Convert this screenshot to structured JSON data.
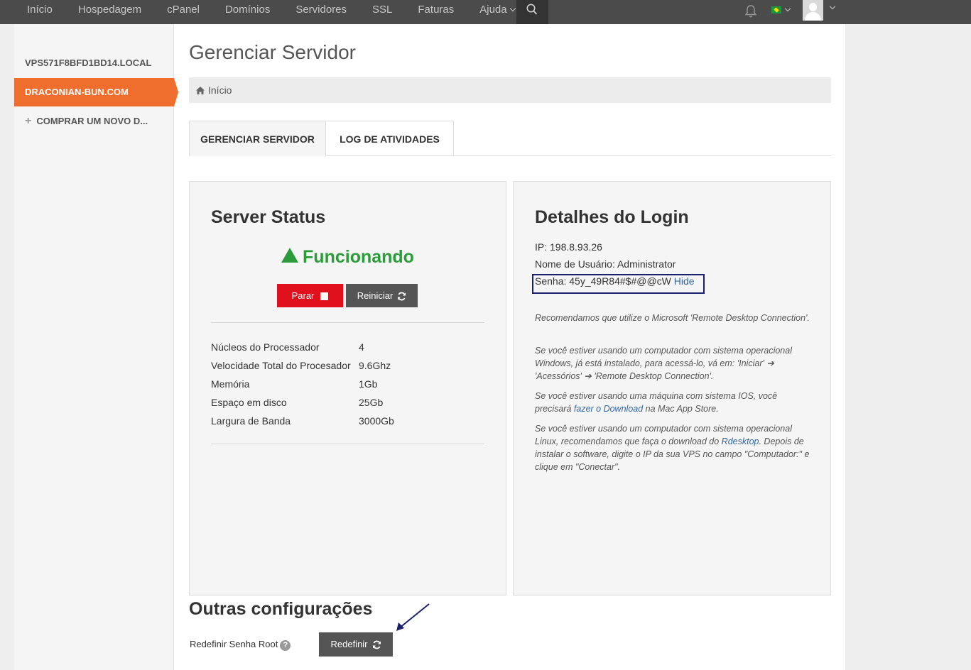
{
  "nav": {
    "items": [
      "Início",
      "Hospedagem",
      "cPanel",
      "Domínios",
      "Servidores",
      "SSL",
      "Faturas",
      "Ajuda"
    ]
  },
  "icons": {
    "search": "search-icon",
    "bell": "bell-icon",
    "flag": "brazil-flag-icon",
    "avatar": "user-avatar-icon",
    "home": "home-icon",
    "refresh": "refresh-icon",
    "stop": "stop-icon",
    "help": "question-circle-icon",
    "status": "up-triangle-icon"
  },
  "sidebar": {
    "items": [
      {
        "label": "VPS571F8BFD1BD14.LOCAL"
      },
      {
        "label": "DRACONIAN-BUN.COM"
      },
      {
        "label": "COMPRAR UM NOVO D..."
      }
    ]
  },
  "page": {
    "title": "Gerenciar Servidor",
    "breadcrumb": "Início"
  },
  "tabs": [
    "GERENCIAR SERVIDOR",
    "LOG DE ATIVIDADES"
  ],
  "server_status": {
    "title": "Server Status",
    "status": "Funcionando",
    "stop_label": "Parar",
    "restart_label": "Reiniciar",
    "specs": [
      {
        "key": "Núcleos do Processador",
        "value": "4"
      },
      {
        "key": "Velocidade Total do Procesador",
        "value": "9.6Ghz"
      },
      {
        "key": "Memória",
        "value": "1Gb"
      },
      {
        "key": "Espaço em disco",
        "value": "25Gb"
      },
      {
        "key": "Largura de Banda",
        "value": "3000Gb"
      }
    ]
  },
  "login": {
    "title": "Detalhes do Login",
    "ip": "IP: 198.8.93.26",
    "username": "Nome de Usuário: Administrator",
    "password": "Senha: 45y_49R84#$#@@cW",
    "hide_label": "Hide",
    "note1": "Recomendamos que utilize o Microsoft 'Remote Desktop Connection'.",
    "note2": "Se você estiver usando um computador com sistema operacional Windows, já está instalado, para acessá-lo, vá em: 'Iniciar' ➔ 'Acessórios' ➔ 'Remote Desktop Connection'.",
    "note3_pre": "Se você estiver usando uma máquina com sistema IOS, você precisará ",
    "note3_link": "fazer o Download",
    "note3_post": " na Mac App Store.",
    "note4_pre": "Se você estiver usando um computador com sistema operacional Linux, recomendamos que faça o download do ",
    "note4_link": "Rdesktop",
    "note4_post": ". Depois de instalar o software, digite o IP da sua VPS no campo \"Computador:\" e clique em \"Conectar\"."
  },
  "other": {
    "title": "Outras configurações",
    "reset_label": "Redefinir Senha Root",
    "reset_button": "Redefinir"
  },
  "colors": {
    "accent": "#f06e2d",
    "stop": "#e0101d",
    "status": "#2a9d3a",
    "highlight_box": "#1a2270"
  }
}
